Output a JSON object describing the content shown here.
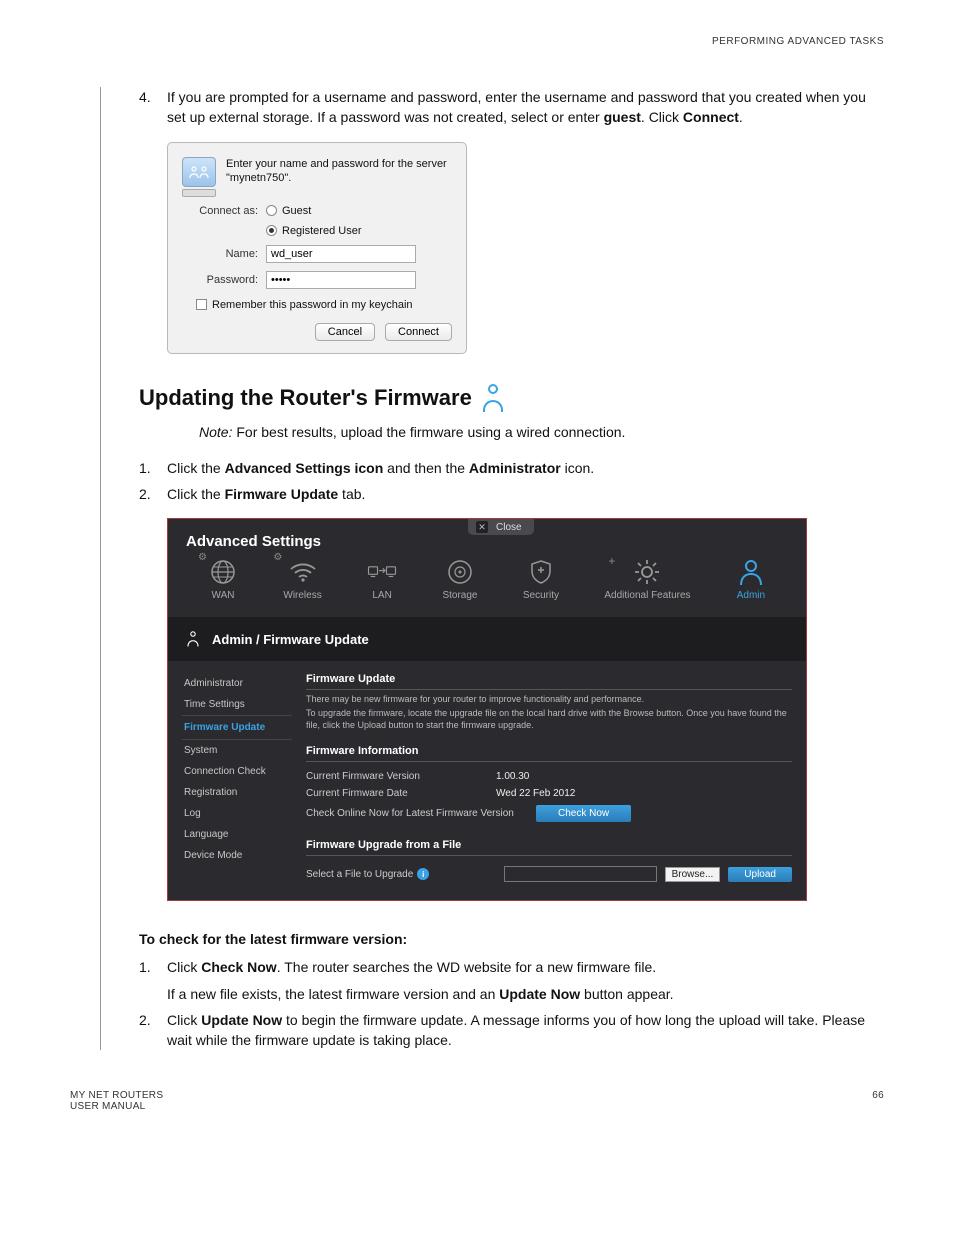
{
  "header": {
    "right": "PERFORMING ADVANCED TASKS"
  },
  "step4": {
    "num": "4.",
    "text_a": "If you are prompted for a username and password, enter the username and password that you created when you set up external storage. If a password was not created, select or enter ",
    "bold_guest": "guest",
    "text_b": ". Click ",
    "bold_connect": "Connect",
    "text_c": "."
  },
  "dialog": {
    "prompt": "Enter your name and password for the server \"mynetn750\".",
    "connect_as": "Connect as:",
    "guest": "Guest",
    "registered": "Registered User",
    "name_label": "Name:",
    "name_value": "wd_user",
    "pass_label": "Password:",
    "pass_value": "•••••",
    "remember": "Remember this password in my keychain",
    "cancel": "Cancel",
    "connect": "Connect"
  },
  "section_title": "Updating the Router's Firmware",
  "note": {
    "label": "Note:",
    "text": "  For best results, upload the firmware using a wired connection."
  },
  "steps12": {
    "s1num": "1.",
    "s1a": "Click the ",
    "s1b": "Advanced Settings icon",
    "s1c": " and then the ",
    "s1d": "Administrator",
    "s1e": " icon.",
    "s2num": "2.",
    "s2a": "Click the ",
    "s2b": "Firmware Update",
    "s2c": " tab."
  },
  "router": {
    "title": "Advanced Settings",
    "close": "Close",
    "nav": [
      "WAN",
      "Wireless",
      "LAN",
      "Storage",
      "Security",
      "Additional Features",
      "Admin"
    ],
    "crumb": "Admin / Firmware Update",
    "side": [
      "Administrator",
      "Time Settings",
      "Firmware Update",
      "System",
      "Connection Check",
      "Registration",
      "Log",
      "Language",
      "Device Mode"
    ],
    "fu_head": "Firmware Update",
    "fu_help1": "There may be new firmware for your router to improve functionality and performance.",
    "fu_help2": "To upgrade the firmware, locate the upgrade file on the local hard drive with the Browse button. Once you have found the file, click the Upload button to start the firmware upgrade.",
    "fi_head": "Firmware Information",
    "row_ver_label": "Current Firmware Version",
    "row_ver_val": "1.00.30",
    "row_date_label": "Current Firmware Date",
    "row_date_val": "Wed 22 Feb 2012",
    "row_check_label": "Check Online Now for Latest Firmware Version",
    "check_now": "Check Now",
    "upg_head": "Firmware Upgrade from a File",
    "select_label": "Select a File to Upgrade",
    "browse": "Browse...",
    "upload": "Upload"
  },
  "check_section": {
    "head": "To check for the latest firmware version:",
    "s1num": "1.",
    "s1a": "Click ",
    "s1b": "Check Now",
    "s1c": ". The router searches the WD website for a new firmware file.",
    "s1line2a": "If a new file exists, the latest firmware version and an ",
    "s1line2b": "Update Now",
    "s1line2c": " button appear.",
    "s2num": "2.",
    "s2a": "Click ",
    "s2b": "Update Now",
    "s2c": " to begin the firmware update. A message informs you of how long the upload will take. Please wait while the firmware update is taking place."
  },
  "footer": {
    "left1": "MY NET ROUTERS",
    "left2": "USER MANUAL",
    "page": "66"
  }
}
